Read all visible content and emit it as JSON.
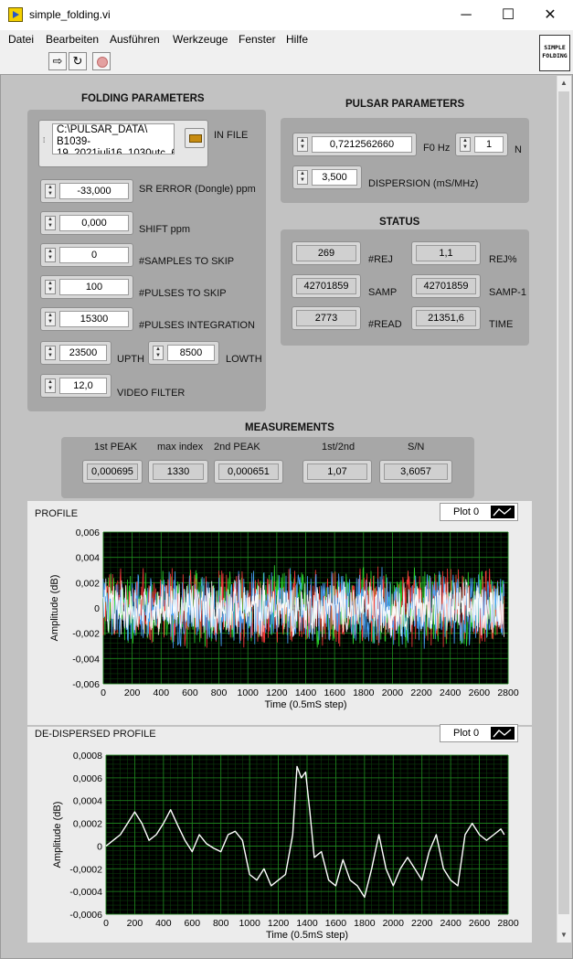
{
  "window": {
    "title": "simple_folding.vi"
  },
  "window_controls": {
    "minimize": "─",
    "maximize": "☐",
    "close": "✕"
  },
  "menu": [
    "Datei",
    "Bearbeiten",
    "Ausführen",
    "Werkzeuge",
    "Fenster",
    "Hilfe"
  ],
  "toolbar": {
    "run_icon": "run-arrow-icon",
    "run_cont_icon": "run-continuously-icon",
    "abort_icon": "abort-stop-icon"
  },
  "logo": {
    "line1": "SIMPLE",
    "line2": "FOLDING"
  },
  "folding": {
    "header": "FOLDING PARAMETERS",
    "in_file_label": "IN FILE",
    "in_file_value": "C:\\PULSAR_DATA\\\nB1039-\n19_2021juli16_1030utc_6",
    "sr_error": {
      "label": "SR ERROR (Dongle) ppm",
      "value": "-33,000"
    },
    "shift": {
      "label": "SHIFT ppm",
      "value": "0,000"
    },
    "samples_skip": {
      "label": "#SAMPLES TO SKIP",
      "value": "0"
    },
    "pulses_skip": {
      "label": "#PULSES TO SKIP",
      "value": "100"
    },
    "pulses_integration": {
      "label": "#PULSES INTEGRATION",
      "value": "15300"
    },
    "upth": {
      "label": "UPTH",
      "value": "23500"
    },
    "lowth": {
      "label": "LOWTH",
      "value": "8500"
    },
    "video_filter": {
      "label": "VIDEO FILTER",
      "value": "12,0"
    }
  },
  "pulsar": {
    "header": "PULSAR PARAMETERS",
    "f0": {
      "label": "F0 Hz",
      "value": "0,7212562660"
    },
    "n": {
      "label": "N",
      "value": "1"
    },
    "dispersion": {
      "label": "DISPERSION (mS/MHz)",
      "value": "3,500"
    }
  },
  "status": {
    "header": "STATUS",
    "rej": {
      "label": "#REJ",
      "value": "269"
    },
    "rej_pct": {
      "label": "REJ%",
      "value": "1,1"
    },
    "samp": {
      "label": "SAMP",
      "value": "42701859"
    },
    "samp_1": {
      "label": "SAMP-1",
      "value": "42701859"
    },
    "read": {
      "label": "#READ",
      "value": "2773"
    },
    "time": {
      "label": "TIME",
      "value": "21351,6"
    }
  },
  "measurements": {
    "header": "MEASUREMENTS",
    "first_peak": {
      "label": "1st PEAK",
      "value": "0,000695"
    },
    "max_index": {
      "label": "max index",
      "value": "1330"
    },
    "second_peak": {
      "label": "2nd PEAK",
      "value": "0,000651"
    },
    "ratio": {
      "label": "1st/2nd",
      "value": "1,07"
    },
    "sn": {
      "label": "S/N",
      "value": "3,6057"
    }
  },
  "profile": {
    "title": "PROFILE",
    "legend": "Plot 0",
    "ylabel": "Amplitude (dB)",
    "xlabel": "Time (0.5mS step)",
    "yticks": [
      "0,006",
      "0,004",
      "0,002",
      "0",
      "-0,002",
      "-0,004",
      "-0,006"
    ],
    "xticks": [
      "0",
      "200",
      "400",
      "600",
      "800",
      "1000",
      "1200",
      "1400",
      "1600",
      "1800",
      "2000",
      "2200",
      "2400",
      "2600",
      "2800"
    ]
  },
  "dedispersed": {
    "title": "DE-DISPERSED PROFILE",
    "legend": "Plot 0",
    "ylabel": "Amplitude (dB)",
    "xlabel": "Time (0.5mS step)",
    "yticks": [
      "0,0008",
      "0,0006",
      "0,0004",
      "0,0002",
      "0",
      "-0,0002",
      "-0,0004",
      "-0,0006"
    ],
    "xticks": [
      "0",
      "200",
      "400",
      "600",
      "800",
      "1000",
      "1200",
      "1400",
      "1600",
      "1800",
      "2000",
      "2200",
      "2400",
      "2600",
      "2800"
    ]
  },
  "chart_data": [
    {
      "type": "line",
      "title": "PROFILE",
      "xlabel": "Time (0.5mS step)",
      "ylabel": "Amplitude (dB)",
      "xlim": [
        0,
        2800
      ],
      "ylim": [
        -0.006,
        0.006
      ],
      "grid": true,
      "legend": "top-right",
      "series": [
        {
          "name": "Plot 0",
          "color": "#ffffff",
          "description_values": "noise approx. ±0.003 around 0 across x 0–2773"
        }
      ],
      "overlay_colors": [
        "#2bd92b",
        "#ff3c3c",
        "#4aa6ff",
        "#ffffff"
      ]
    },
    {
      "type": "line",
      "title": "DE-DISPERSED PROFILE",
      "xlabel": "Time (0.5mS step)",
      "ylabel": "Amplitude (dB)",
      "xlim": [
        0,
        2800
      ],
      "ylim": [
        -0.0006,
        0.0008
      ],
      "grid": true,
      "legend": "top-right",
      "series": [
        {
          "name": "Plot 0",
          "color": "#ffffff",
          "x": [
            0,
            50,
            100,
            150,
            200,
            250,
            300,
            350,
            400,
            450,
            500,
            550,
            600,
            650,
            700,
            750,
            800,
            850,
            900,
            950,
            1000,
            1050,
            1100,
            1150,
            1200,
            1250,
            1300,
            1330,
            1360,
            1390,
            1420,
            1450,
            1500,
            1550,
            1600,
            1650,
            1700,
            1750,
            1800,
            1850,
            1900,
            1950,
            2000,
            2050,
            2100,
            2150,
            2200,
            2250,
            2300,
            2350,
            2400,
            2450,
            2500,
            2550,
            2600,
            2650,
            2700,
            2750,
            2773
          ],
          "y": [
            0.0,
            5e-05,
            0.0001,
            0.0002,
            0.0003,
            0.0002,
            5e-05,
            0.0001,
            0.0002,
            0.00032,
            0.00018,
            5e-05,
            -5e-05,
            0.0001,
            2e-05,
            -2e-05,
            -5e-05,
            0.0001,
            0.00013,
            5e-05,
            -0.00025,
            -0.0003,
            -0.0002,
            -0.00035,
            -0.0003,
            -0.00025,
            0.0001,
            0.0007,
            0.0006,
            0.00065,
            0.0003,
            -0.0001,
            -5e-05,
            -0.0003,
            -0.00035,
            -0.00012,
            -0.0003,
            -0.00035,
            -0.00045,
            -0.0002,
            0.0001,
            -0.0002,
            -0.00035,
            -0.0002,
            -0.0001,
            -0.0002,
            -0.0003,
            -5e-05,
            0.0001,
            -0.0002,
            -0.0003,
            -0.00035,
            0.0001,
            0.0002,
            0.0001,
            5e-05,
            0.0001,
            0.00015,
            0.0001
          ]
        }
      ]
    }
  ]
}
